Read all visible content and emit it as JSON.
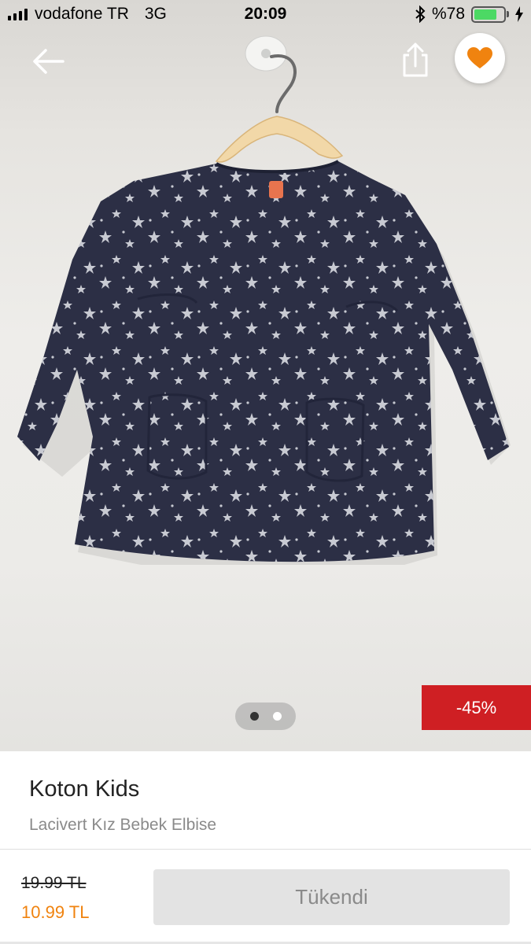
{
  "status_bar": {
    "carrier": "vodafone TR",
    "network": "3G",
    "time": "20:09",
    "battery_text": "%78",
    "battery_level": 0.78,
    "battery_color": "#4cd964"
  },
  "header": {
    "back_icon": "arrow-left-icon",
    "share_icon": "share-icon",
    "favorite_icon": "heart-icon",
    "favorite_color": "#f0830f"
  },
  "gallery": {
    "image_subject": "navy star-print baby dress on hanger",
    "page_count": 2,
    "current_page": 1
  },
  "badge": {
    "discount": "-45%",
    "color": "#cf1f23"
  },
  "product": {
    "brand": "Koton Kids",
    "name": "Lacivert Kız Bebek Elbise",
    "old_price": "19.99 TL",
    "new_price": "10.99 TL",
    "price_color": "#f0830f",
    "button_label": "Tükendi"
  }
}
